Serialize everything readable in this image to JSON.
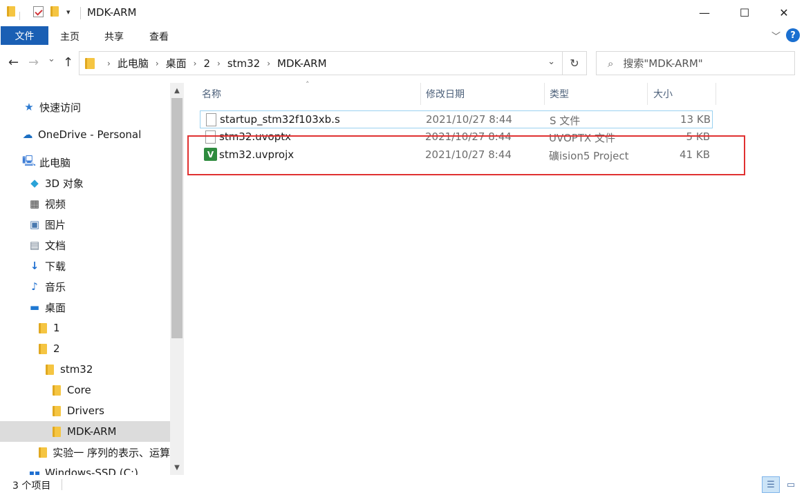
{
  "window": {
    "title": "MDK-ARM",
    "controls": {
      "minimize": "—",
      "maximize": "☐",
      "close": "✕"
    }
  },
  "quick_access": {
    "dropdown": "▾"
  },
  "ribbon": {
    "tabs": [
      {
        "label": "文件",
        "active": true
      },
      {
        "label": "主页"
      },
      {
        "label": "共享"
      },
      {
        "label": "查看"
      }
    ],
    "expand": "﹀",
    "help": "?"
  },
  "navigation": {
    "back": "←",
    "forward": "→",
    "recent": "⌄",
    "up": "↑"
  },
  "address": {
    "crumbs": [
      "此电脑",
      "桌面",
      "2",
      "stm32",
      "MDK-ARM"
    ],
    "separator": "›",
    "dropdown": "⌄",
    "refresh": "↻"
  },
  "search": {
    "placeholder": "搜索\"MDK-ARM\"",
    "icon": "⌕"
  },
  "sidebar": {
    "scroll_up": "▲",
    "scroll_down": "▼",
    "items": [
      {
        "label": "快速访问",
        "icon": "star-icon"
      },
      {
        "label": "OneDrive - Personal",
        "icon": "cloud-icon"
      },
      {
        "label": "此电脑",
        "icon": "computer-icon"
      },
      {
        "label": "3D 对象",
        "icon": "cube-icon"
      },
      {
        "label": "视频",
        "icon": "video-icon"
      },
      {
        "label": "图片",
        "icon": "picture-icon"
      },
      {
        "label": "文档",
        "icon": "document-icon"
      },
      {
        "label": "下载",
        "icon": "download-icon"
      },
      {
        "label": "音乐",
        "icon": "music-icon"
      },
      {
        "label": "桌面",
        "icon": "desktop-icon"
      },
      {
        "label": "1",
        "icon": "folder-icon"
      },
      {
        "label": "2",
        "icon": "folder-icon"
      },
      {
        "label": "stm32",
        "icon": "folder-icon"
      },
      {
        "label": "Core",
        "icon": "folder-icon"
      },
      {
        "label": "Drivers",
        "icon": "folder-icon"
      },
      {
        "label": "MDK-ARM",
        "icon": "folder-icon",
        "selected": true
      },
      {
        "label": "实验一 序列的表示、运算",
        "icon": "folder-icon"
      },
      {
        "label": "Windows-SSD (C:)",
        "icon": "drive-icon"
      }
    ]
  },
  "file_list": {
    "columns": [
      "名称",
      "修改日期",
      "类型",
      "大小"
    ],
    "sort_indicator": "˄",
    "rows": [
      {
        "name": "startup_stm32f103xb.s",
        "date": "2021/10/27 8:44",
        "type": "S 文件",
        "size": "13 KB",
        "icon": "file-icon"
      },
      {
        "name": "stm32.uvoptx",
        "date": "2021/10/27 8:44",
        "type": "UVOPTX 文件",
        "size": "5 KB",
        "icon": "file-icon"
      },
      {
        "name": "stm32.uvprojx",
        "date": "2021/10/27 8:44",
        "type": "礦ision5 Project",
        "size": "41 KB",
        "icon": "uvision-icon"
      }
    ]
  },
  "status": {
    "item_count": "3 个项目"
  },
  "colors": {
    "accent": "#1a5fb4",
    "highlight_box": "#e03030",
    "selection": "#dcdcdc"
  }
}
